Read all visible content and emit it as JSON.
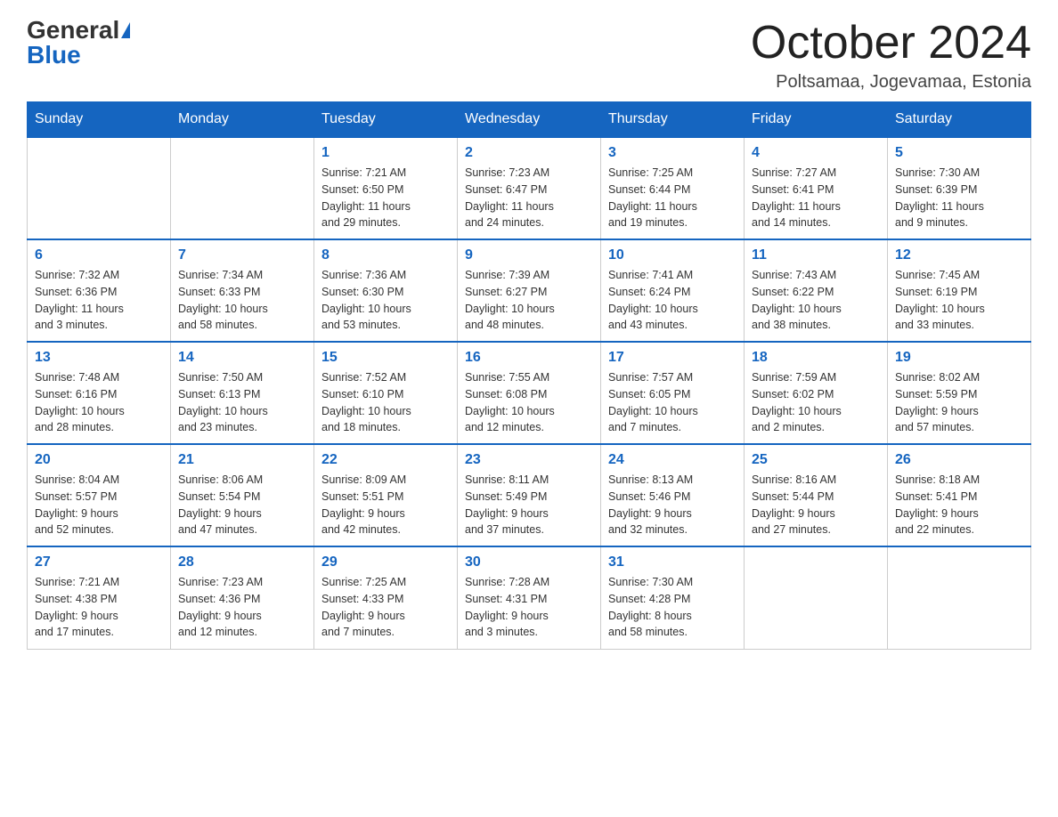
{
  "header": {
    "logo_general": "General",
    "logo_blue": "Blue",
    "month_title": "October 2024",
    "location": "Poltsamaa, Jogevamaa, Estonia"
  },
  "days_of_week": [
    "Sunday",
    "Monday",
    "Tuesday",
    "Wednesday",
    "Thursday",
    "Friday",
    "Saturday"
  ],
  "weeks": [
    [
      {
        "day": "",
        "info": ""
      },
      {
        "day": "",
        "info": ""
      },
      {
        "day": "1",
        "info": "Sunrise: 7:21 AM\nSunset: 6:50 PM\nDaylight: 11 hours\nand 29 minutes."
      },
      {
        "day": "2",
        "info": "Sunrise: 7:23 AM\nSunset: 6:47 PM\nDaylight: 11 hours\nand 24 minutes."
      },
      {
        "day": "3",
        "info": "Sunrise: 7:25 AM\nSunset: 6:44 PM\nDaylight: 11 hours\nand 19 minutes."
      },
      {
        "day": "4",
        "info": "Sunrise: 7:27 AM\nSunset: 6:41 PM\nDaylight: 11 hours\nand 14 minutes."
      },
      {
        "day": "5",
        "info": "Sunrise: 7:30 AM\nSunset: 6:39 PM\nDaylight: 11 hours\nand 9 minutes."
      }
    ],
    [
      {
        "day": "6",
        "info": "Sunrise: 7:32 AM\nSunset: 6:36 PM\nDaylight: 11 hours\nand 3 minutes."
      },
      {
        "day": "7",
        "info": "Sunrise: 7:34 AM\nSunset: 6:33 PM\nDaylight: 10 hours\nand 58 minutes."
      },
      {
        "day": "8",
        "info": "Sunrise: 7:36 AM\nSunset: 6:30 PM\nDaylight: 10 hours\nand 53 minutes."
      },
      {
        "day": "9",
        "info": "Sunrise: 7:39 AM\nSunset: 6:27 PM\nDaylight: 10 hours\nand 48 minutes."
      },
      {
        "day": "10",
        "info": "Sunrise: 7:41 AM\nSunset: 6:24 PM\nDaylight: 10 hours\nand 43 minutes."
      },
      {
        "day": "11",
        "info": "Sunrise: 7:43 AM\nSunset: 6:22 PM\nDaylight: 10 hours\nand 38 minutes."
      },
      {
        "day": "12",
        "info": "Sunrise: 7:45 AM\nSunset: 6:19 PM\nDaylight: 10 hours\nand 33 minutes."
      }
    ],
    [
      {
        "day": "13",
        "info": "Sunrise: 7:48 AM\nSunset: 6:16 PM\nDaylight: 10 hours\nand 28 minutes."
      },
      {
        "day": "14",
        "info": "Sunrise: 7:50 AM\nSunset: 6:13 PM\nDaylight: 10 hours\nand 23 minutes."
      },
      {
        "day": "15",
        "info": "Sunrise: 7:52 AM\nSunset: 6:10 PM\nDaylight: 10 hours\nand 18 minutes."
      },
      {
        "day": "16",
        "info": "Sunrise: 7:55 AM\nSunset: 6:08 PM\nDaylight: 10 hours\nand 12 minutes."
      },
      {
        "day": "17",
        "info": "Sunrise: 7:57 AM\nSunset: 6:05 PM\nDaylight: 10 hours\nand 7 minutes."
      },
      {
        "day": "18",
        "info": "Sunrise: 7:59 AM\nSunset: 6:02 PM\nDaylight: 10 hours\nand 2 minutes."
      },
      {
        "day": "19",
        "info": "Sunrise: 8:02 AM\nSunset: 5:59 PM\nDaylight: 9 hours\nand 57 minutes."
      }
    ],
    [
      {
        "day": "20",
        "info": "Sunrise: 8:04 AM\nSunset: 5:57 PM\nDaylight: 9 hours\nand 52 minutes."
      },
      {
        "day": "21",
        "info": "Sunrise: 8:06 AM\nSunset: 5:54 PM\nDaylight: 9 hours\nand 47 minutes."
      },
      {
        "day": "22",
        "info": "Sunrise: 8:09 AM\nSunset: 5:51 PM\nDaylight: 9 hours\nand 42 minutes."
      },
      {
        "day": "23",
        "info": "Sunrise: 8:11 AM\nSunset: 5:49 PM\nDaylight: 9 hours\nand 37 minutes."
      },
      {
        "day": "24",
        "info": "Sunrise: 8:13 AM\nSunset: 5:46 PM\nDaylight: 9 hours\nand 32 minutes."
      },
      {
        "day": "25",
        "info": "Sunrise: 8:16 AM\nSunset: 5:44 PM\nDaylight: 9 hours\nand 27 minutes."
      },
      {
        "day": "26",
        "info": "Sunrise: 8:18 AM\nSunset: 5:41 PM\nDaylight: 9 hours\nand 22 minutes."
      }
    ],
    [
      {
        "day": "27",
        "info": "Sunrise: 7:21 AM\nSunset: 4:38 PM\nDaylight: 9 hours\nand 17 minutes."
      },
      {
        "day": "28",
        "info": "Sunrise: 7:23 AM\nSunset: 4:36 PM\nDaylight: 9 hours\nand 12 minutes."
      },
      {
        "day": "29",
        "info": "Sunrise: 7:25 AM\nSunset: 4:33 PM\nDaylight: 9 hours\nand 7 minutes."
      },
      {
        "day": "30",
        "info": "Sunrise: 7:28 AM\nSunset: 4:31 PM\nDaylight: 9 hours\nand 3 minutes."
      },
      {
        "day": "31",
        "info": "Sunrise: 7:30 AM\nSunset: 4:28 PM\nDaylight: 8 hours\nand 58 minutes."
      },
      {
        "day": "",
        "info": ""
      },
      {
        "day": "",
        "info": ""
      }
    ]
  ]
}
